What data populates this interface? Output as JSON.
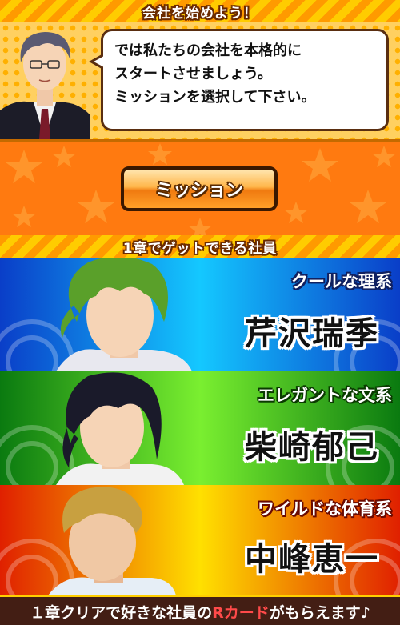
{
  "top_banner": {
    "title": "会社を始めよう！"
  },
  "dialog": {
    "lines": [
      "では私たちの会社を本格的に",
      "スタートさせましょう。",
      "ミッションを選択して下さい。"
    ]
  },
  "mission_button": {
    "label": "ミッション"
  },
  "employee_banner": {
    "title": "1章でゲットできる社員"
  },
  "employees": [
    {
      "type": "クールな理系",
      "name": "芹沢瑞季",
      "hair_color": "#5aa02a"
    },
    {
      "type": "エレガントな文系",
      "name": "柴崎郁己",
      "hair_color": "#1a1a2a"
    },
    {
      "type": "ワイルドな体育系",
      "name": "中峰恵一",
      "hair_color": "#c8a040"
    }
  ],
  "footer": {
    "text_before": "１章クリアで好きな社員の",
    "highlight": "Rカード",
    "text_after": "がもらえます♪",
    "highlight_color": "#ff4a4a"
  }
}
